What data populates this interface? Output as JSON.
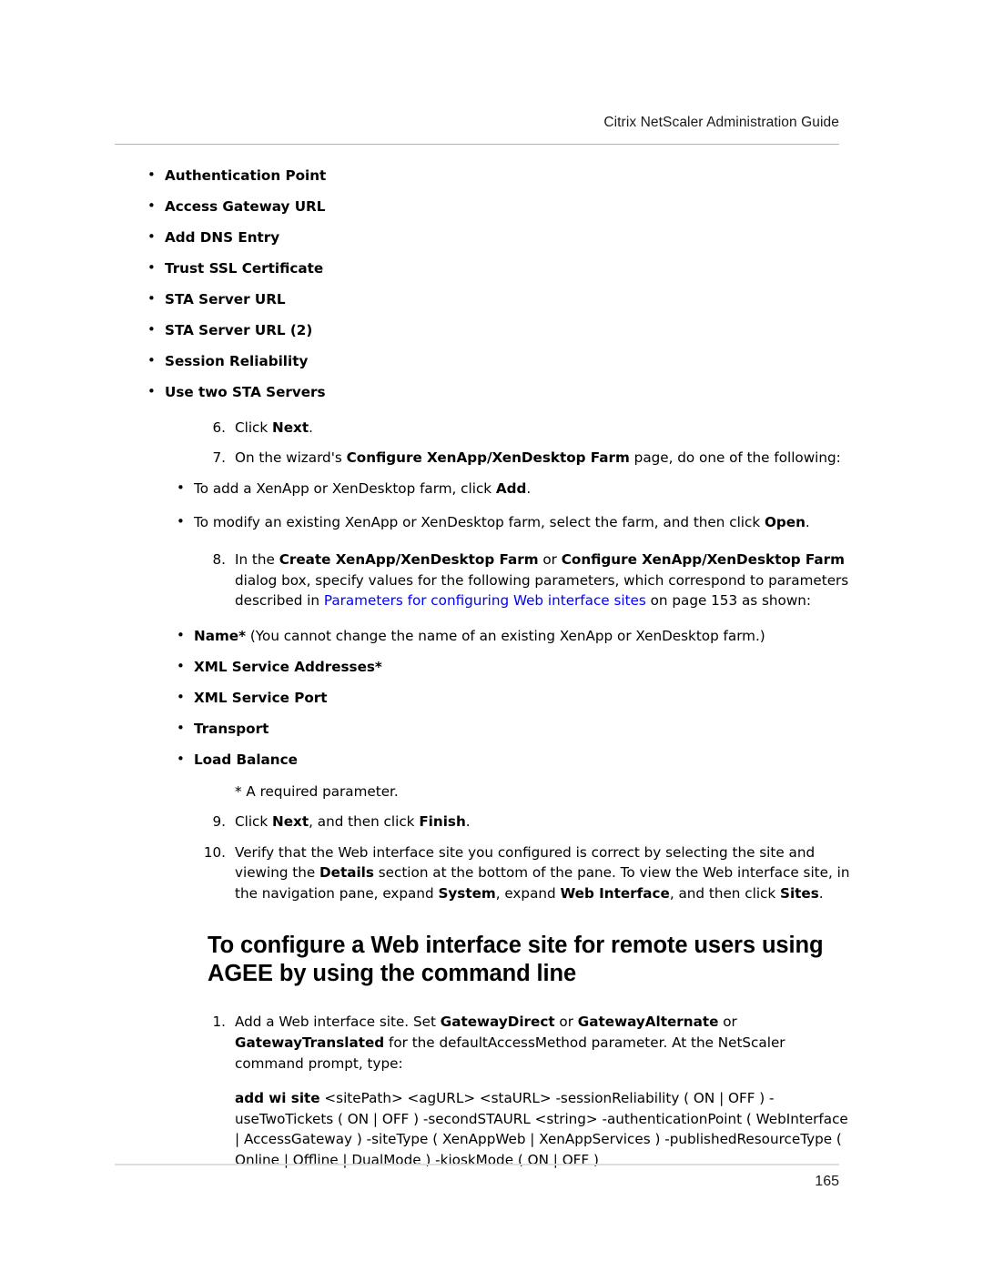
{
  "document": {
    "running_header": "Citrix NetScaler Administration Guide",
    "page_number": "165"
  },
  "colors": {
    "text": "#000000",
    "hyperlink": "#0000FF",
    "header_text": "#1A1A1A",
    "header_rule": "#B5B5B5",
    "footer_rule": "#DEDEDE",
    "page_background": "#FFFFFF"
  },
  "wizard_fields": {
    "items": [
      "Authentication Point",
      "Access Gateway URL",
      "Add DNS Entry",
      "Trust SSL Certificate",
      "STA Server URL",
      "STA Server URL (2)",
      "Session Reliability",
      "Use two STA Servers"
    ]
  },
  "steps_gui": [
    {
      "number": "6.",
      "segments": [
        {
          "text": "Click ",
          "style": "normal"
        },
        {
          "text": "Next",
          "style": "bold"
        },
        {
          "text": ".",
          "style": "normal"
        }
      ]
    },
    {
      "number": "7.",
      "segments": [
        {
          "text": "On the wizard's ",
          "style": "normal"
        },
        {
          "text": "Configure XenApp/XenDesktop Farm",
          "style": "bold"
        },
        {
          "text": " page, do one of the following:",
          "style": "normal"
        }
      ]
    }
  ],
  "step7_bullets": [
    {
      "segments": [
        {
          "text": "To add a XenApp or XenDesktop farm, click ",
          "style": "normal"
        },
        {
          "text": "Add",
          "style": "bold"
        },
        {
          "text": ".",
          "style": "normal"
        }
      ]
    },
    {
      "segments": [
        {
          "text": "To modify an existing XenApp or XenDesktop farm, select the farm, and then click ",
          "style": "normal"
        },
        {
          "text": "Open",
          "style": "bold"
        },
        {
          "text": ".",
          "style": "normal"
        }
      ]
    }
  ],
  "step8": {
    "number": "8.",
    "segments": [
      {
        "text": "In the ",
        "style": "normal"
      },
      {
        "text": "Create XenApp/XenDesktop Farm",
        "style": "bold"
      },
      {
        "text": " or ",
        "style": "normal"
      },
      {
        "text": "Configure XenApp/XenDesktop Farm",
        "style": "bold"
      },
      {
        "text": " dialog box, specify values for the following parameters, which correspond to parameters described in ",
        "style": "normal"
      },
      {
        "text": "Parameters for configuring Web interface sites",
        "style": "link"
      },
      {
        "text": " on page 153 as shown:",
        "style": "normal"
      }
    ]
  },
  "step8_bullets": [
    {
      "segments": [
        {
          "text": "Name*",
          "style": "bold"
        },
        {
          "text": " (You cannot change the name of an existing XenApp or XenDesktop farm.)",
          "style": "normal"
        }
      ]
    },
    {
      "segments": [
        {
          "text": "XML Service Addresses*",
          "style": "bold"
        }
      ]
    },
    {
      "segments": [
        {
          "text": "XML Service Port",
          "style": "bold"
        }
      ]
    },
    {
      "segments": [
        {
          "text": "Transport",
          "style": "bold"
        }
      ]
    },
    {
      "segments": [
        {
          "text": "Load Balance",
          "style": "bold"
        }
      ]
    }
  ],
  "required_note": "* A required parameter.",
  "steps_gui_tail": [
    {
      "number": "9.",
      "segments": [
        {
          "text": "Click ",
          "style": "normal"
        },
        {
          "text": "Next",
          "style": "bold"
        },
        {
          "text": ", and then click ",
          "style": "normal"
        },
        {
          "text": "Finish",
          "style": "bold"
        },
        {
          "text": ".",
          "style": "normal"
        }
      ]
    },
    {
      "number": "10.",
      "segments": [
        {
          "text": "Verify that the Web interface site you configured is correct by selecting the site and viewing the ",
          "style": "normal"
        },
        {
          "text": "Details",
          "style": "bold"
        },
        {
          "text": " section at the bottom of the pane. To view the Web interface site, in the navigation pane, expand ",
          "style": "normal"
        },
        {
          "text": "System",
          "style": "bold"
        },
        {
          "text": ", expand ",
          "style": "normal"
        },
        {
          "text": "Web Interface",
          "style": "bold"
        },
        {
          "text": ", and then click ",
          "style": "normal"
        },
        {
          "text": "Sites",
          "style": "bold"
        },
        {
          "text": ".",
          "style": "normal"
        }
      ]
    }
  ],
  "section_heading": "To configure a Web interface site for remote users using AGEE by using the command line",
  "steps_cli": [
    {
      "number": "1.",
      "segments": [
        {
          "text": "Add a Web interface site. Set ",
          "style": "normal"
        },
        {
          "text": "GatewayDirect",
          "style": "bold"
        },
        {
          "text": " or ",
          "style": "normal"
        },
        {
          "text": "GatewayAlternate",
          "style": "bold"
        },
        {
          "text": " or ",
          "style": "normal"
        },
        {
          "text": "GatewayTranslated",
          "style": "bold"
        },
        {
          "text": " for the defaultAccessMethod parameter. At the NetScaler command prompt, type:",
          "style": "normal"
        }
      ]
    }
  ],
  "command_block": {
    "command_name": "add wi site",
    "arguments": " <sitePath> <agURL> <staURL> -sessionReliability ( ON | OFF ) -useTwoTickets ( ON | OFF ) -secondSTAURL <string> -authenticationPoint ( WebInterface | AccessGateway ) -siteType ( XenAppWeb | XenAppServices ) -publishedResourceType ( Online | Offline | DualMode ) -kioskMode ( ON | OFF )"
  }
}
